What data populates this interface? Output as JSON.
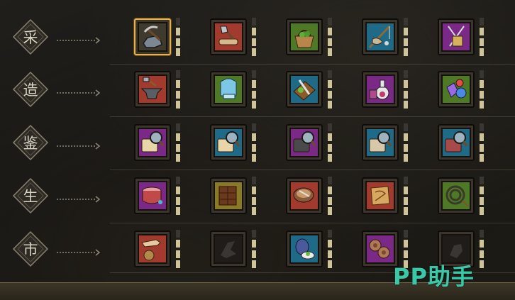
{
  "categories": [
    {
      "label": "采"
    },
    {
      "label": "造"
    },
    {
      "label": "鉴"
    },
    {
      "label": "生"
    },
    {
      "label": "市"
    }
  ],
  "rows": [
    {
      "skills": [
        {
          "icon": "pickaxe-ore-icon",
          "bg": "#3f3a2e",
          "selected": true,
          "level": 4
        },
        {
          "icon": "axe-log-icon",
          "bg": "#a33a2e",
          "level": 4
        },
        {
          "icon": "herb-basket-icon",
          "bg": "#4f7a25",
          "level": 4
        },
        {
          "icon": "fishing-rod-icon",
          "bg": "#1f6a86",
          "level": 4
        },
        {
          "icon": "knitting-needles-icon",
          "bg": "#7a2a86",
          "level": 4
        }
      ]
    },
    {
      "skills": [
        {
          "icon": "anvil-hammer-icon",
          "bg": "#a33a2e",
          "level": 4
        },
        {
          "icon": "tailoring-armor-icon",
          "bg": "#4f7a25",
          "level": 4
        },
        {
          "icon": "cooking-board-icon",
          "bg": "#1f6a86",
          "level": 4
        },
        {
          "icon": "alchemy-flask-icon",
          "bg": "#7a2a86",
          "level": 4
        },
        {
          "icon": "gem-crystal-icon",
          "bg": "#4f7a25",
          "level": 4
        }
      ]
    },
    {
      "skills": [
        {
          "icon": "appraise-scroll-icon",
          "bg": "#7a2a86",
          "level": 4
        },
        {
          "icon": "appraise-armor-icon",
          "bg": "#1f6a86",
          "level": 4
        },
        {
          "icon": "appraise-anvil-icon",
          "bg": "#7a2a86",
          "level": 4
        },
        {
          "icon": "appraise-plate-icon",
          "bg": "#1f6a86",
          "level": 4
        },
        {
          "icon": "appraise-jewelry-icon",
          "bg": "#1f6a86",
          "level": 4
        }
      ]
    },
    {
      "skills": [
        {
          "icon": "drum-icon",
          "bg": "#7a2a86",
          "level": 4
        },
        {
          "icon": "chocolate-bar-icon",
          "bg": "#8a7a24",
          "level": 4
        },
        {
          "icon": "cooking-pot-icon",
          "bg": "#a33a2e",
          "level": 4
        },
        {
          "icon": "map-scroll-icon",
          "bg": "#a33a2e",
          "level": 4
        },
        {
          "icon": "whip-icon",
          "bg": "#4f7a25",
          "level": 4
        }
      ]
    },
    {
      "skills": [
        {
          "icon": "coin-pouch-hand-icon",
          "bg": "#a33a2e",
          "level": 4
        },
        {
          "icon": "locked-hand-icon",
          "bg": "#2a2622",
          "locked": true,
          "level": 4
        },
        {
          "icon": "plum-herb-icon",
          "bg": "#1f6a86",
          "level": 4
        },
        {
          "icon": "cookie-gears-icon",
          "bg": "#7a2a86",
          "level": 4
        },
        {
          "icon": "locked-item-icon",
          "bg": "#2a2622",
          "locked": true,
          "level": 4
        }
      ]
    }
  ],
  "watermark": {
    "text": "PP助手"
  }
}
